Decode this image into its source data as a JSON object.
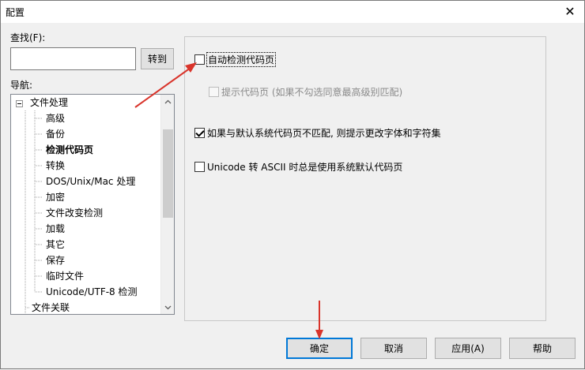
{
  "window": {
    "title": "配置",
    "close_glyph": "✕"
  },
  "search": {
    "label": "查找(F):",
    "value": "",
    "placeholder": "",
    "goto_label": "转到"
  },
  "nav": {
    "label": "导航:",
    "items": [
      {
        "label": "文件处理",
        "level": 0,
        "expanded": true
      },
      {
        "label": "高级",
        "level": 1
      },
      {
        "label": "备份",
        "level": 1
      },
      {
        "label": "检测代码页",
        "level": 1,
        "selected": true
      },
      {
        "label": "转换",
        "level": 1
      },
      {
        "label": "DOS/Unix/Mac 处理",
        "level": 1
      },
      {
        "label": "加密",
        "level": 1
      },
      {
        "label": "文件改变检测",
        "level": 1
      },
      {
        "label": "加载",
        "level": 1
      },
      {
        "label": "其它",
        "level": 1
      },
      {
        "label": "保存",
        "level": 1
      },
      {
        "label": "临时文件",
        "level": 1
      },
      {
        "label": "Unicode/UTF-8 检测",
        "level": 1
      },
      {
        "label": "文件关联",
        "level": 0
      }
    ]
  },
  "options": [
    {
      "label": "自动检测代码页",
      "checked": false,
      "enabled": true,
      "focused": true
    },
    {
      "label": "提示代码页 (如果不勾选同意最高级别匹配)",
      "checked": false,
      "enabled": false
    },
    {
      "label": "如果与默认系统代码页不匹配, 则提示更改字体和字符集",
      "checked": true,
      "enabled": true
    },
    {
      "label": "Unicode 转 ASCII 时总是使用系统默认代码页",
      "checked": false,
      "enabled": true
    }
  ],
  "buttons": {
    "ok": "确定",
    "cancel": "取消",
    "apply": "应用(A)",
    "help": "帮助"
  },
  "icons": {
    "expander": "tree-expander-icon",
    "scroll_up": "scroll-up-arrow-icon",
    "scroll_down": "scroll-down-arrow-icon",
    "annotation_arrow": "red-arrow-icon"
  },
  "colors": {
    "annotation": "#d9342b",
    "focus_border": "#0078d7",
    "dialog_bg": "#f0f0f0"
  }
}
